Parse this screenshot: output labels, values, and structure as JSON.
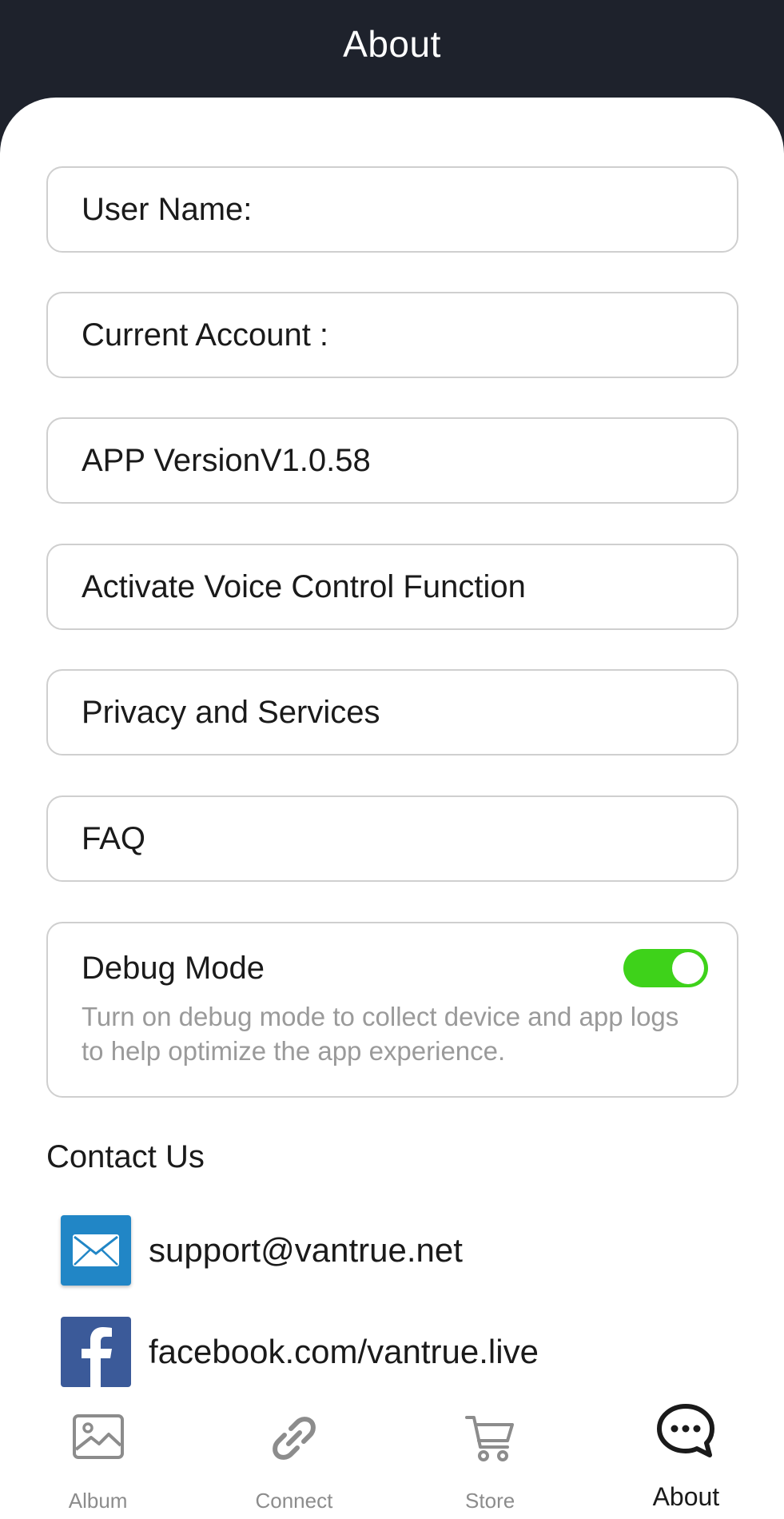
{
  "header": {
    "title": "About"
  },
  "cards": {
    "user_name": "User Name:",
    "current_account": "Current Account :",
    "app_version": "APP VersionV1.0.58",
    "voice_control": "Activate Voice Control Function",
    "privacy": "Privacy and Services",
    "faq": "FAQ"
  },
  "debug": {
    "title": "Debug Mode",
    "description": "Turn on debug mode to collect device and app logs to help optimize the app experience.",
    "enabled": true
  },
  "contact": {
    "heading": "Contact Us",
    "email": "support@vantrue.net",
    "facebook": "facebook.com/vantrue.live"
  },
  "tabs": {
    "album": "Album",
    "connect": "Connect",
    "store": "Store",
    "about": "About",
    "active": "about"
  },
  "colors": {
    "header_bg": "#1e222c",
    "toggle_on": "#3ed21a",
    "mail_blue": "#2186c6",
    "facebook_blue": "#3b5a99"
  }
}
